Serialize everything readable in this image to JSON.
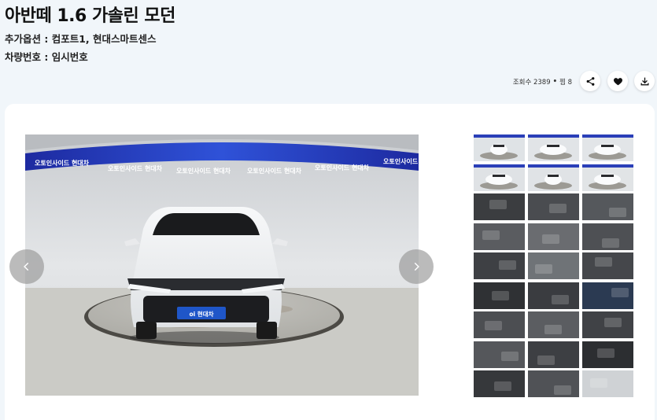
{
  "listing": {
    "title": "아반떼 1.6 가솔린 모던",
    "options_line": "추가옵션 : 컴포트1, 현대스마트센스",
    "plate_line": "차량번호 : 임시번호"
  },
  "stats": {
    "views": "조회수 2389",
    "separator": "•",
    "likes": "찜 8"
  },
  "actions": {
    "share_icon": "share-icon",
    "like_icon": "heart-icon",
    "download_icon": "download-icon"
  },
  "gallery": {
    "banner_texts": [
      "오토인사이드 현대차",
      "오토인사이드 현대차",
      "오토인사이드 현대차",
      "오토인사이드 현대차",
      "오토인사이드 현대차",
      "오토인사이드 현대차"
    ],
    "plate_badge": "oi 현대차",
    "prev_icon": "chevron-left-icon",
    "next_icon": "chevron-right-icon",
    "thumbnails": [
      {
        "subject": "front-exterior",
        "tone": "#dfe3e6"
      },
      {
        "subject": "front-angle-exterior",
        "tone": "#e1e4e7"
      },
      {
        "subject": "side-exterior",
        "tone": "#e2e5e8"
      },
      {
        "subject": "rear-angle-exterior",
        "tone": "#dfe2e5"
      },
      {
        "subject": "rear-exterior",
        "tone": "#e0e3e6"
      },
      {
        "subject": "rear-side-exterior",
        "tone": "#e1e4e6"
      },
      {
        "subject": "trunk",
        "tone": "#3b3d40"
      },
      {
        "subject": "console-detail",
        "tone": "#4a4c50"
      },
      {
        "subject": "engine-bay",
        "tone": "#55585c"
      },
      {
        "subject": "door-panel",
        "tone": "#5a5c60"
      },
      {
        "subject": "seat-controls",
        "tone": "#6a6c70"
      },
      {
        "subject": "gear-knob",
        "tone": "#4e5054"
      },
      {
        "subject": "dashboard",
        "tone": "#3e4044"
      },
      {
        "subject": "infotainment",
        "tone": "#6f7377"
      },
      {
        "subject": "climate-panel",
        "tone": "#45474b"
      },
      {
        "subject": "door-trim",
        "tone": "#2f3134"
      },
      {
        "subject": "center-console",
        "tone": "#3a3c40"
      },
      {
        "subject": "instrument-cluster",
        "tone": "#2b3a52"
      },
      {
        "subject": "steering-wheel",
        "tone": "#4c4e52"
      },
      {
        "subject": "steering-side",
        "tone": "#5b5d61"
      },
      {
        "subject": "shifter",
        "tone": "#404246"
      },
      {
        "subject": "rear-seat",
        "tone": "#55575b"
      },
      {
        "subject": "cup-holder",
        "tone": "#3d3f43"
      },
      {
        "subject": "door-handle",
        "tone": "#2c2e31"
      },
      {
        "subject": "floor-mat",
        "tone": "#36383b"
      },
      {
        "subject": "seat-detail",
        "tone": "#505256"
      },
      {
        "subject": "wheel",
        "tone": "#cfd2d5"
      }
    ]
  },
  "colors": {
    "page_bg": "#f1f6fa",
    "card_bg": "#ffffff",
    "banner_blue": "#2a3fb8"
  }
}
